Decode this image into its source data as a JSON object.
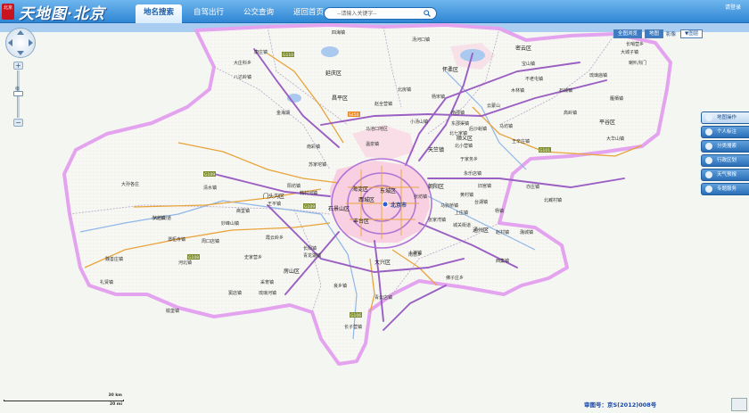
{
  "header": {
    "logo_seal": "北京",
    "logo_text": "天地图·北京",
    "tabs": [
      {
        "label": "地名搜索",
        "active": true
      },
      {
        "label": "自驾出行",
        "active": false
      },
      {
        "label": "公交查询",
        "active": false
      },
      {
        "label": "返回首页",
        "active": false
      }
    ],
    "search_placeholder": "--请输入关键字--",
    "user_link": "请登录"
  },
  "map_controls": {
    "zoom_in": "+",
    "zoom_out": "−",
    "zoom_note": "级"
  },
  "map_switch": {
    "buttons": [
      {
        "label": "全图浏览",
        "active": true
      },
      {
        "label": "地图",
        "active": true
      },
      {
        "label": "影像",
        "active": false
      }
    ],
    "more": "▼图层"
  },
  "tools": [
    "地图操作",
    "个人标注",
    "分类搜索",
    "行政区划",
    "天气预报",
    "专题服务"
  ],
  "map": {
    "capital": "北京市",
    "districts": [
      "延庆区",
      "怀柔区",
      "密云区",
      "昌平区",
      "顺义区",
      "平谷区",
      "门头沟区",
      "海淀区",
      "朝阳区",
      "东城区",
      "西城区",
      "石景山区",
      "丰台区",
      "通州区",
      "房山区",
      "大兴区",
      "天竺镇"
    ],
    "towns": [
      "大庄科乡",
      "康庄镇",
      "八达岭镇",
      "四海镇",
      "汤河口镇",
      "长哨营乡",
      "云蒙山",
      "石城镇",
      "不老屯镇",
      "高岭镇",
      "大城子镇",
      "琉璃庙镇",
      "雁栖镇",
      "宝山镇",
      "喇叭沟门",
      "杨宋镇",
      "北房镇",
      "南邵镇",
      "赵全营镇",
      "木林镇",
      "东邵渠镇",
      "大华山镇",
      "王辛庄镇",
      "马坊镇",
      "金海湖",
      "马池口地区",
      "小汤山镇",
      "北七家镇",
      "后沙峪镇",
      "北小营镇",
      "南彩镇",
      "苏家坨镇",
      "阳坊镇",
      "温泉镇",
      "上庄镇",
      "张家湾镇",
      "台湖镇",
      "潞城镇",
      "西集镇",
      "永乐店镇",
      "大孙各庄",
      "清水镇",
      "斋堂镇",
      "大台街道",
      "妙峰山镇",
      "王平镇",
      "永定镇",
      "潭柘寺镇",
      "史家营乡",
      "霞云岭乡",
      "周口店镇",
      "河北镇",
      "青龙湖镇",
      "南窖乡",
      "佛子庄乡",
      "良乡镇",
      "长阳镇",
      "青云店镇",
      "长子营镇",
      "采育镇",
      "魏善庄镇",
      "礼贤镇",
      "榆垡镇",
      "窦店镇",
      "琉璃河镇",
      "十渡镇",
      "张坊镇",
      "韩村河镇",
      "城关街道",
      "马驹桥镇",
      "于家务乡",
      "黄村镇",
      "旧宫镇",
      "亦庄镇",
      "北臧村镇",
      "杨镇",
      "赵村镇"
    ],
    "roads": [
      "G110",
      "G109",
      "G101",
      "G111",
      "G108",
      "G106",
      "S450"
    ]
  },
  "scale": {
    "km": "30 km",
    "mi": "20 mi"
  },
  "approval": "审图号：京S(2012)008号",
  "colors": {
    "header": "#2f86d4",
    "district_fill": "#f9c6dc",
    "boundary": "#e4a3ef",
    "highway": "#9a5fc2",
    "national_road": "#e8a43a",
    "river": "#8fb6e8"
  }
}
